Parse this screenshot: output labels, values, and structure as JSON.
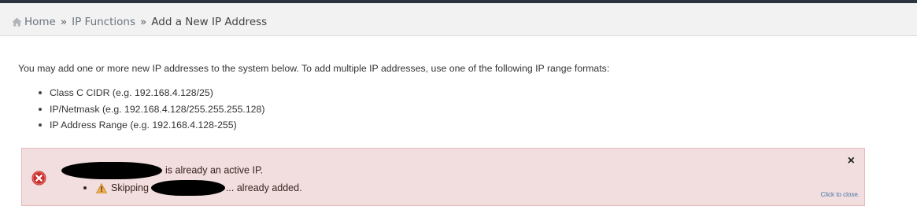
{
  "breadcrumb": {
    "home_label": "Home",
    "separator": "»",
    "items": [
      "IP Functions"
    ],
    "current": "Add a New IP Address"
  },
  "intro_text": "You may add one or more new IP addresses to the system below. To add multiple IP addresses, use one of the following IP range formats:",
  "formats": [
    "Class C CIDR (e.g. 192.168.4.128/25)",
    "IP/Netmask (e.g. 192.168.4.128/255.255.255.128)",
    "IP Address Range (e.g. 192.168.4.128-255)"
  ],
  "alert": {
    "type": "error",
    "line1_suffix": "is already an active IP.",
    "line2_prefix": "Skipping",
    "line2_suffix": "... already added.",
    "close_label": "×",
    "click_to_close": "Click to close.",
    "colors": {
      "background": "#f2dede",
      "border": "#e5b8b8",
      "error_icon": "#c9302c",
      "warning_icon": "#f0ad4e"
    }
  },
  "icons": [
    "home-icon",
    "error-icon",
    "warning-icon",
    "close-icon"
  ]
}
